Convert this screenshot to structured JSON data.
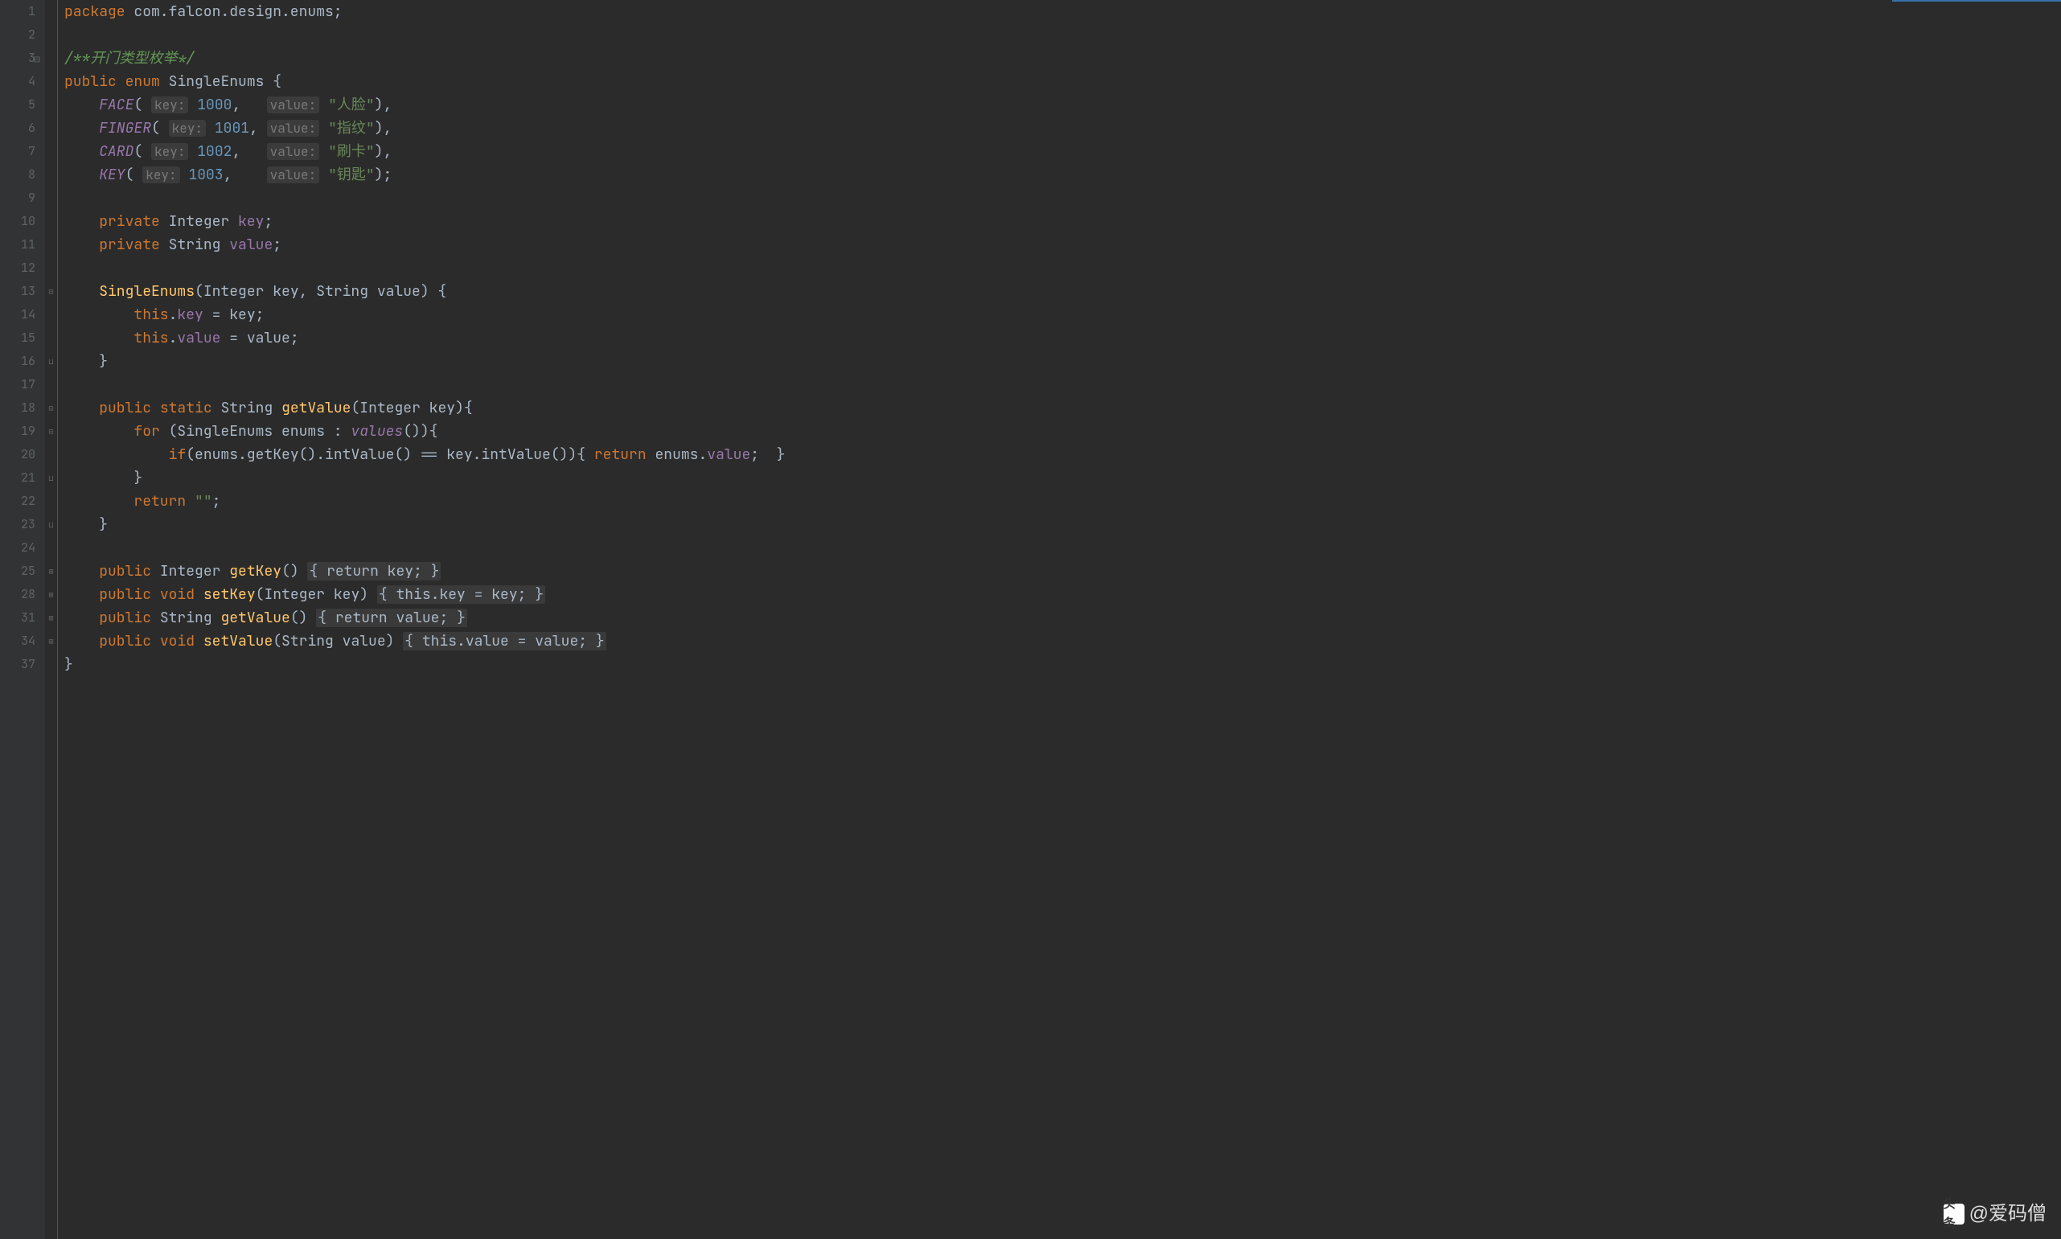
{
  "lineNumbers": [
    "1",
    "2",
    "3",
    "4",
    "5",
    "6",
    "7",
    "8",
    "9",
    "10",
    "11",
    "12",
    "13",
    "14",
    "15",
    "16",
    "17",
    "18",
    "19",
    "20",
    "21",
    "22",
    "23",
    "24",
    "25",
    "28",
    "31",
    "34",
    "37"
  ],
  "code": {
    "package_kw": "package",
    "package_name": " com.falcon.design.enums;",
    "comment": "/**开门类型枚举*/",
    "public_kw": "public",
    "enum_kw": "enum",
    "class_name": "SingleEnums",
    "open_brace": " {",
    "enum_face": "FACE",
    "enum_finger": "FINGER",
    "enum_card": "CARD",
    "enum_key": "KEY",
    "hint_key": "key:",
    "hint_value": "value:",
    "val_1000": "1000",
    "val_1001": "1001",
    "val_1002": "1002",
    "val_1003": "1003",
    "str_face": "\"人脸\"",
    "str_finger": "\"指纹\"",
    "str_card": "\"刷卡\"",
    "str_key": "\"钥匙\"",
    "comma_close": "),",
    "semi_close": ");",
    "private_kw": "private",
    "integer_type": "Integer",
    "string_type": "String",
    "field_key": "key",
    "field_value": "value",
    "semi": ";",
    "ctor_name": "SingleEnums",
    "ctor_params": "(Integer key, String value) {",
    "this_kw": "this",
    "dot": ".",
    "eq": " = ",
    "assign_key": "key;",
    "assign_value": "value;",
    "close_brace": "}",
    "static_kw": "static",
    "method_getvalue": "getValue",
    "getvalue_params": "(Integer key){",
    "for_kw": "for",
    "for_head_open": " (SingleEnums enums : ",
    "values_call": "values",
    "values_close": "()){",
    "if_kw": "if",
    "if_open": "(enums.",
    "getkey_call": "getKey",
    "intvalue_call": "intValue",
    "if_mid": "().",
    "if_eq": "() == key.",
    "if_end": "()){ ",
    "return_kw": "return",
    "return_enums_value": " enums.",
    "return_value_field": "value",
    "return_close": ";  }",
    "return_empty": "\"\"",
    "method_getkey": "getKey",
    "getkey_sig": "() ",
    "fold_body_key": "{ return key; }",
    "void_kw": "void",
    "method_setkey": "setKey",
    "setkey_params": "(Integer key) ",
    "fold_body_setkey": "{ this.key = key; }",
    "getvalue2_sig": "() ",
    "fold_body_value": "{ return value; }",
    "method_setvalue": "setValue",
    "setvalue_params": "(String value) ",
    "fold_body_setvalue": "{ this.value = value; }"
  },
  "watermark": {
    "logo_text": "头条",
    "handle": "@爱码僧"
  }
}
